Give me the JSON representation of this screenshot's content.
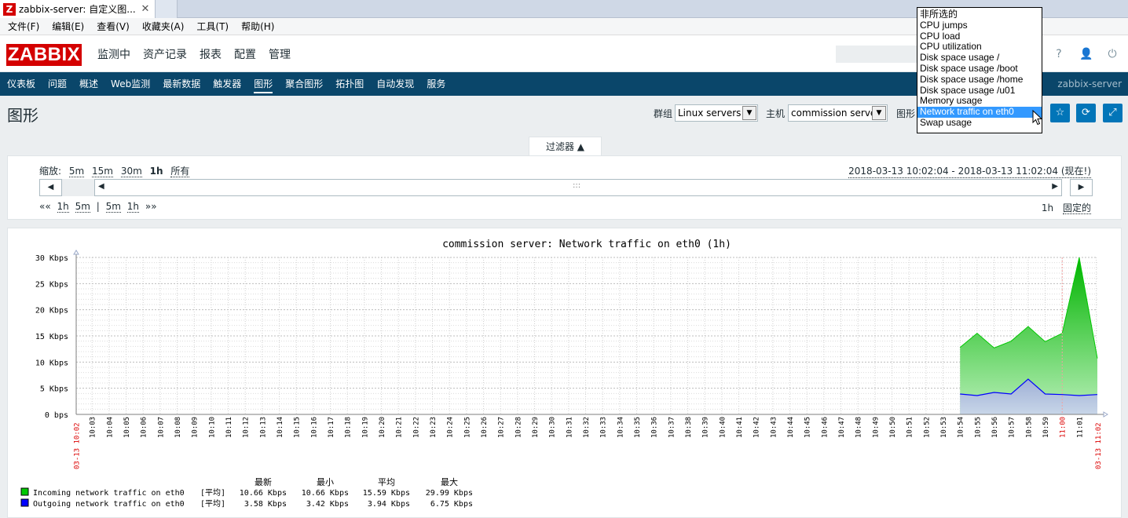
{
  "browser": {
    "tab_title": "zabbix-server: 自定义图...",
    "close_glyph": "✕",
    "favicon_letter": "Z"
  },
  "menubar": [
    "文件(F)",
    "编辑(E)",
    "查看(V)",
    "收藏夹(A)",
    "工具(T)",
    "帮助(H)"
  ],
  "header": {
    "logo": "ZABBIX",
    "nav": [
      "监测中",
      "资产记录",
      "报表",
      "配置",
      "管理"
    ],
    "icons": [
      "help-icon",
      "user-icon",
      "power-icon"
    ],
    "help_glyph": "?",
    "user_glyph": "👤",
    "power_glyph": "⏻"
  },
  "subnav": {
    "items": [
      "仪表板",
      "问题",
      "概述",
      "Web监测",
      "最新数据",
      "触发器",
      "图形",
      "聚合图形",
      "拓扑图",
      "自动发现",
      "服务"
    ],
    "active": "图形",
    "server": "zabbix-server"
  },
  "page": {
    "title": "图形",
    "group_label": "群组",
    "group_value": "Linux servers",
    "host_label": "主机",
    "host_value": "commission server",
    "graph_label": "图形",
    "select_arrow": "▼",
    "buttons": [
      "favorite-icon",
      "refresh-icon",
      "fullscreen-icon"
    ],
    "star_glyph": "☆",
    "refresh_glyph": "⟳",
    "fullscreen_glyph": "⤢"
  },
  "filter": {
    "tab_label": "过滤器 ▲",
    "zoom_label": "缩放:",
    "zoom_options": [
      "5m",
      "15m",
      "30m",
      "1h",
      "所有"
    ],
    "zoom_active": "1h",
    "date_range": "2018-03-13 10:02:04 - 2018-03-13 11:02:04 (现在!)",
    "nav_left": [
      "««",
      "1h",
      "5m",
      "|",
      "5m",
      "1h",
      "»»"
    ],
    "period": "1h",
    "fixed": "固定的",
    "prev_glyph": "◀",
    "next_glyph": "▶",
    "handle_glyph": ":::"
  },
  "dropdown": {
    "options": [
      "非所选的",
      "CPU jumps",
      "CPU load",
      "CPU utilization",
      "Disk space usage /",
      "Disk space usage /boot",
      "Disk space usage /home",
      "Disk space usage /u01",
      "Memory usage",
      "Network traffic on eth0",
      "Swap usage"
    ],
    "selected": "Network traffic on eth0"
  },
  "colors": {
    "incoming": "#00c800",
    "outgoing": "#0000ff",
    "brand": "#d40000",
    "nav": "#0a466a",
    "button": "#0275b8",
    "time_red": "#dc0000"
  },
  "chart_data": {
    "type": "area",
    "title": "commission server: Network traffic on eth0 (1h)",
    "ylim": [
      0,
      30
    ],
    "y_ticks": [
      "0 bps",
      "5 Kbps",
      "10 Kbps",
      "15 Kbps",
      "20 Kbps",
      "25 Kbps",
      "30 Kbps"
    ],
    "x_start_label": "03-13 10:02",
    "x_end_label": "03-13 11:02",
    "x_ticks": [
      "10:03",
      "10:04",
      "10:05",
      "10:06",
      "10:07",
      "10:08",
      "10:09",
      "10:10",
      "10:11",
      "10:12",
      "10:13",
      "10:14",
      "10:15",
      "10:16",
      "10:17",
      "10:18",
      "10:19",
      "10:20",
      "10:21",
      "10:22",
      "10:23",
      "10:24",
      "10:25",
      "10:26",
      "10:27",
      "10:28",
      "10:29",
      "10:30",
      "10:31",
      "10:32",
      "10:33",
      "10:34",
      "10:35",
      "10:36",
      "10:37",
      "10:38",
      "10:39",
      "10:40",
      "10:41",
      "10:42",
      "10:43",
      "10:44",
      "10:45",
      "10:46",
      "10:47",
      "10:48",
      "10:49",
      "10:50",
      "10:51",
      "10:52",
      "10:53",
      "10:54",
      "10:55",
      "10:56",
      "10:57",
      "10:58",
      "10:59",
      "11:00",
      "11:01"
    ],
    "x_ticks_red": [
      "11:00"
    ],
    "series": [
      {
        "name": "Incoming network traffic on eth0",
        "times": [
          "10:54",
          "10:55",
          "10:56",
          "10:57",
          "10:58",
          "10:59",
          "11:00",
          "11:01",
          "11:02"
        ],
        "values": [
          12.8,
          15.5,
          12.7,
          14.0,
          16.8,
          13.9,
          15.5,
          29.99,
          10.7
        ]
      },
      {
        "name": "Outgoing network traffic on eth0",
        "times": [
          "10:54",
          "10:55",
          "10:56",
          "10:57",
          "10:58",
          "10:59",
          "11:00",
          "11:01",
          "11:02"
        ],
        "values": [
          3.9,
          3.6,
          4.2,
          3.9,
          6.75,
          3.9,
          3.8,
          3.6,
          3.8
        ]
      }
    ],
    "legend": {
      "headers": [
        "最新",
        "最小",
        "平均",
        "最大"
      ],
      "func": "[平均]",
      "rows": [
        {
          "last": "10.66 Kbps",
          "min": "10.66 Kbps",
          "avg": "15.59 Kbps",
          "max": "29.99 Kbps"
        },
        {
          "last": "3.58 Kbps",
          "min": "3.42 Kbps",
          "avg": "3.94 Kbps",
          "max": "6.75 Kbps"
        }
      ]
    }
  }
}
